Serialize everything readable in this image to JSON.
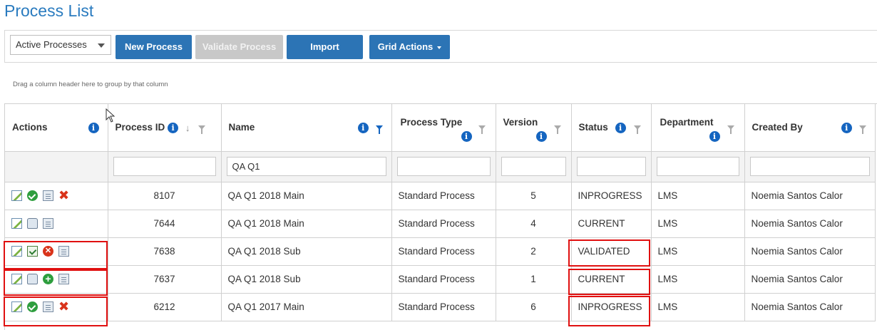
{
  "page": {
    "title": "Process List"
  },
  "toolbar": {
    "filter_select": "Active Processes",
    "new_process": "New Process",
    "validate_process": "Validate Process",
    "import": "Import",
    "grid_actions": "Grid Actions"
  },
  "grid": {
    "group_hint": "Drag a column header here to group by that column",
    "columns": {
      "actions": "Actions",
      "process_id": "Process ID",
      "name": "Name",
      "process_type": "Process Type",
      "version": "Version",
      "status": "Status",
      "department": "Department",
      "created_by": "Created By"
    },
    "filters": {
      "name": "QA Q1"
    },
    "rows": [
      {
        "id": "8107",
        "name": "QA Q1 2018 Main",
        "type": "Standard Process",
        "version": "5",
        "status": "INPROGRESS",
        "department": "LMS",
        "created_by": "Noemia Santos Calor"
      },
      {
        "id": "7644",
        "name": "QA Q1 2018 Main",
        "type": "Standard Process",
        "version": "4",
        "status": "CURRENT",
        "department": "LMS",
        "created_by": "Noemia Santos Calor"
      },
      {
        "id": "7638",
        "name": "QA Q1 2018 Sub",
        "type": "Standard Process",
        "version": "2",
        "status": "VALIDATED",
        "department": "LMS",
        "created_by": "Noemia Santos Calor"
      },
      {
        "id": "7637",
        "name": "QA Q1 2018 Sub",
        "type": "Standard Process",
        "version": "1",
        "status": "CURRENT",
        "department": "LMS",
        "created_by": "Noemia Santos Calor"
      },
      {
        "id": "6212",
        "name": "QA Q1 2017 Main",
        "type": "Standard Process",
        "version": "6",
        "status": "INPROGRESS",
        "department": "LMS",
        "created_by": "Noemia Santos Calor"
      }
    ]
  },
  "colors": {
    "accent": "#2c74b5",
    "title": "#2a7bbf",
    "highlight": "#e01010",
    "info_icon": "#1565c0"
  }
}
